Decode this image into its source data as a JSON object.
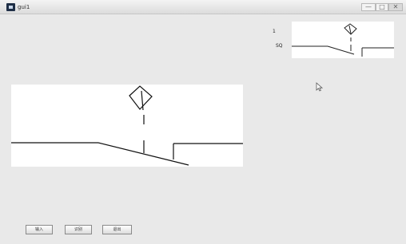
{
  "window": {
    "title": "gui1",
    "controls": {
      "minimize": "—",
      "maximize": "□",
      "close": "✕"
    }
  },
  "labels": {
    "top": "1",
    "bottom": "SQ"
  },
  "buttons": [
    {
      "label": "输入"
    },
    {
      "label": "识别"
    },
    {
      "label": "退出"
    }
  ],
  "icons": {
    "app": "app-icon",
    "cursor": "mouse-pointer-icon"
  }
}
